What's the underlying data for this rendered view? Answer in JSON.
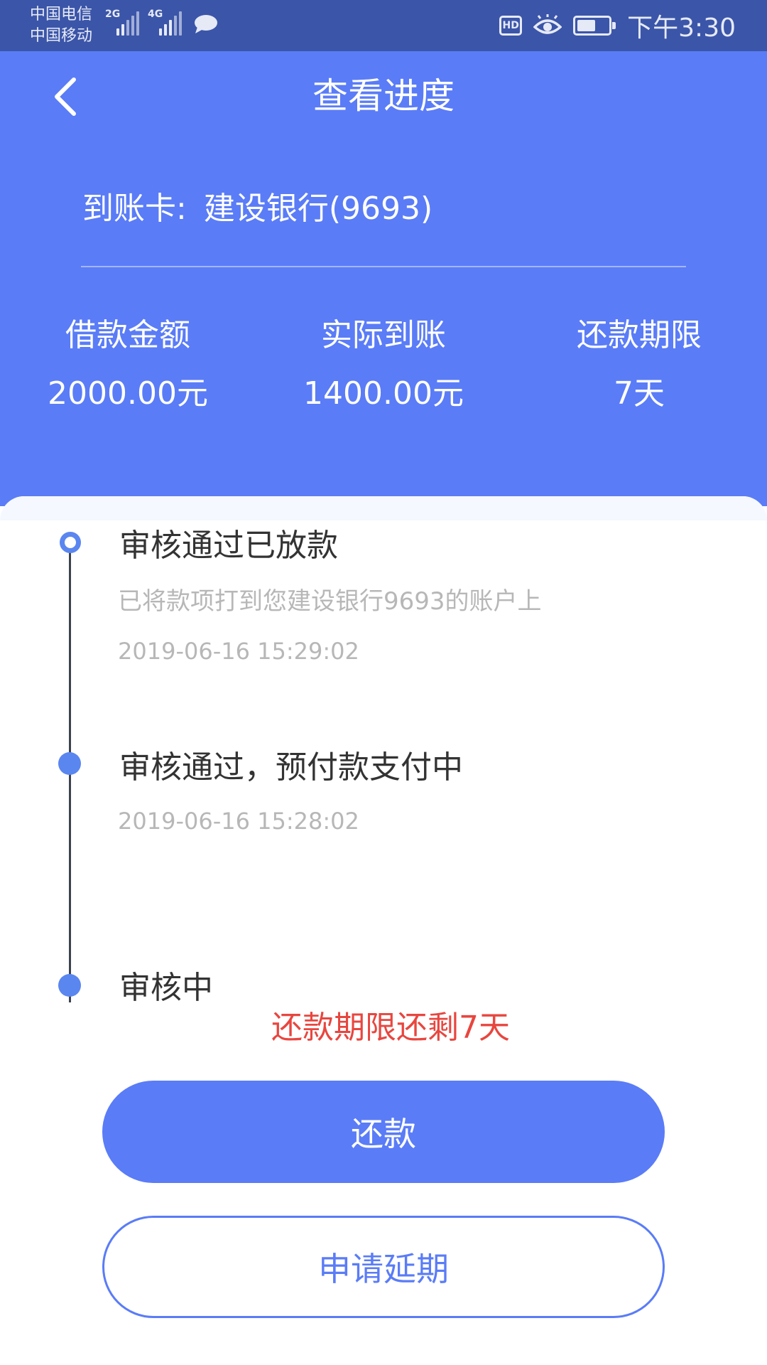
{
  "status_bar": {
    "carrier_1": "中国电信",
    "carrier_2": "中国移动",
    "signal_1_type": "2G",
    "signal_2_type": "4G",
    "hd_label": "HD",
    "time": "下午3:30",
    "battery_level": 0.6,
    "icons": [
      "chat-icon",
      "hd-icon",
      "eye-icon",
      "battery-icon"
    ]
  },
  "header": {
    "title": "查看进度",
    "card_label": "到账卡:",
    "card_value": "建设银行(9693)",
    "back_icon": "chevron-left-icon"
  },
  "stats": [
    {
      "label": "借款金额",
      "value": "2000.00元"
    },
    {
      "label": "实际到账",
      "value": "1400.00元"
    },
    {
      "label": "还款期限",
      "value": "7天"
    }
  ],
  "timeline": [
    {
      "title": "审核通过已放款",
      "desc": "已将款项打到您建设银行9693的账户上",
      "time": "2019-06-16 15:29:02"
    },
    {
      "title": "审核通过，预付款支付中",
      "time": "2019-06-16 15:28:02"
    },
    {
      "title": "审核中"
    }
  ],
  "remain_text": "还款期限还剩7天",
  "buttons": {
    "repay": "还款",
    "extend": "申请延期"
  },
  "colors": {
    "status_bar": "#3b55a8",
    "primary": "#5a7cf7",
    "warning": "#e8463f",
    "muted_text": "#b7b7b7"
  }
}
